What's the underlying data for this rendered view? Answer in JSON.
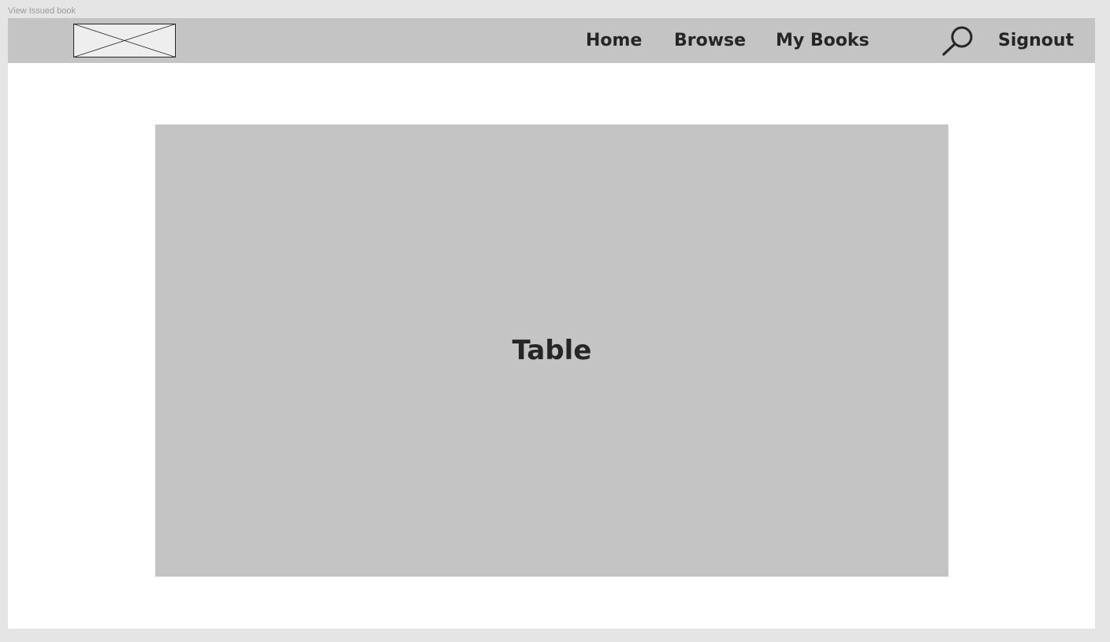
{
  "frame": {
    "label": "View Issued book"
  },
  "header": {
    "logo_icon": "image-placeholder-icon",
    "nav": {
      "home": "Home",
      "browse": "Browse",
      "my_books": "My Books"
    },
    "search_icon": "search-icon",
    "signout": "Signout"
  },
  "main": {
    "table_placeholder_label": "Table"
  },
  "colors": {
    "canvas": "#e5e5e5",
    "frame_bg": "#ffffff",
    "navbar_bg": "#c4c4c4",
    "placeholder_bg": "#c4c4c4",
    "text": "#262626",
    "frame_label": "#9a9a9a"
  }
}
